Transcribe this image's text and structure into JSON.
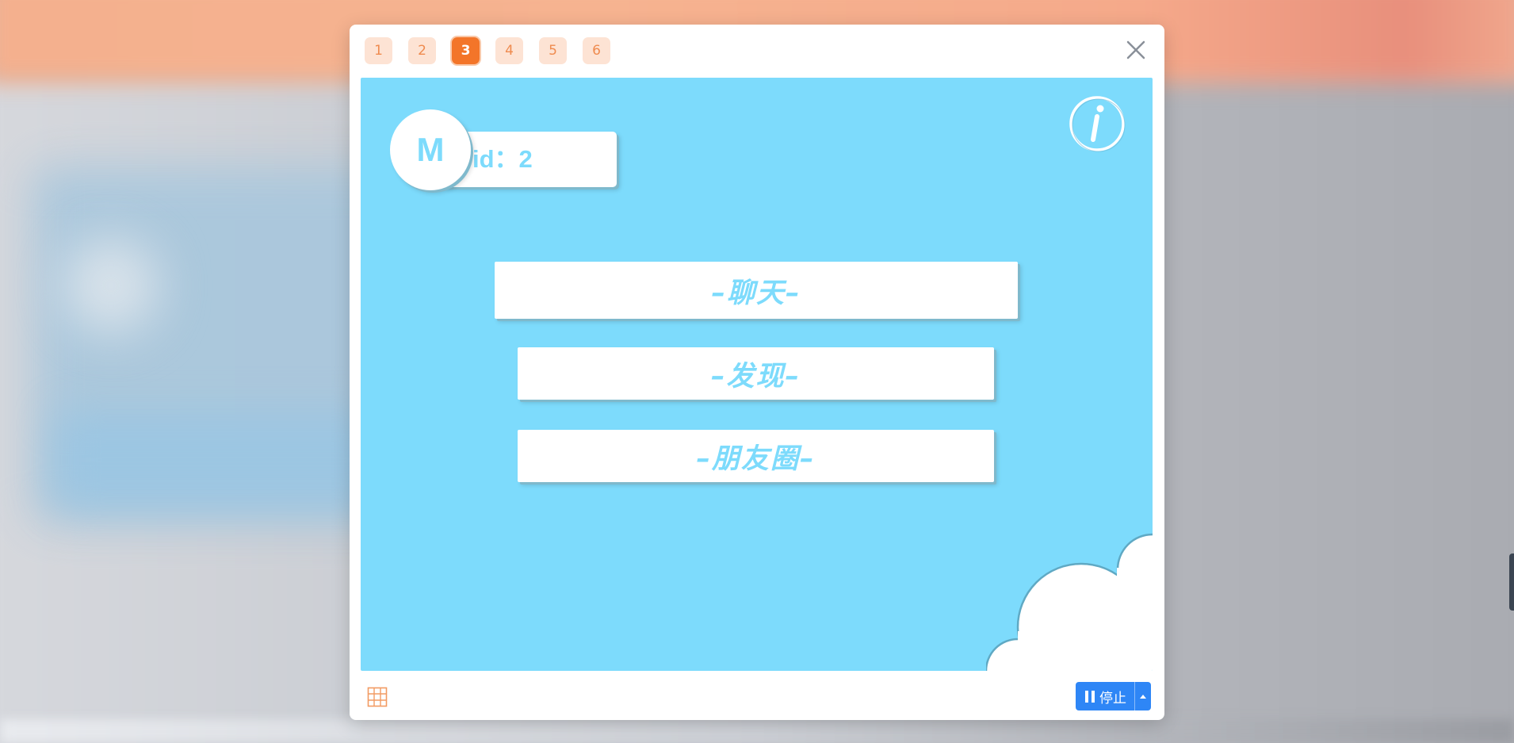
{
  "page_tabs": [
    {
      "label": "1",
      "active": false
    },
    {
      "label": "2",
      "active": false
    },
    {
      "label": "3",
      "active": true
    },
    {
      "label": "4",
      "active": false
    },
    {
      "label": "5",
      "active": false
    },
    {
      "label": "6",
      "active": false
    }
  ],
  "profile": {
    "avatar_letter": "M",
    "id_text": "id：2"
  },
  "menu": {
    "chat": "–聊天–",
    "discover": "–发现–",
    "moments": "–朋友圈–"
  },
  "footer": {
    "stop_label": "停止"
  },
  "colors": {
    "accent_orange": "#f37529",
    "stage_blue": "#7ddbfc",
    "stop_blue": "#2e86f6"
  },
  "icons": {
    "close": "close-icon",
    "info": "info-icon",
    "grid": "grid-icon",
    "pause": "pause-icon",
    "dropdown": "caret-up-icon"
  }
}
